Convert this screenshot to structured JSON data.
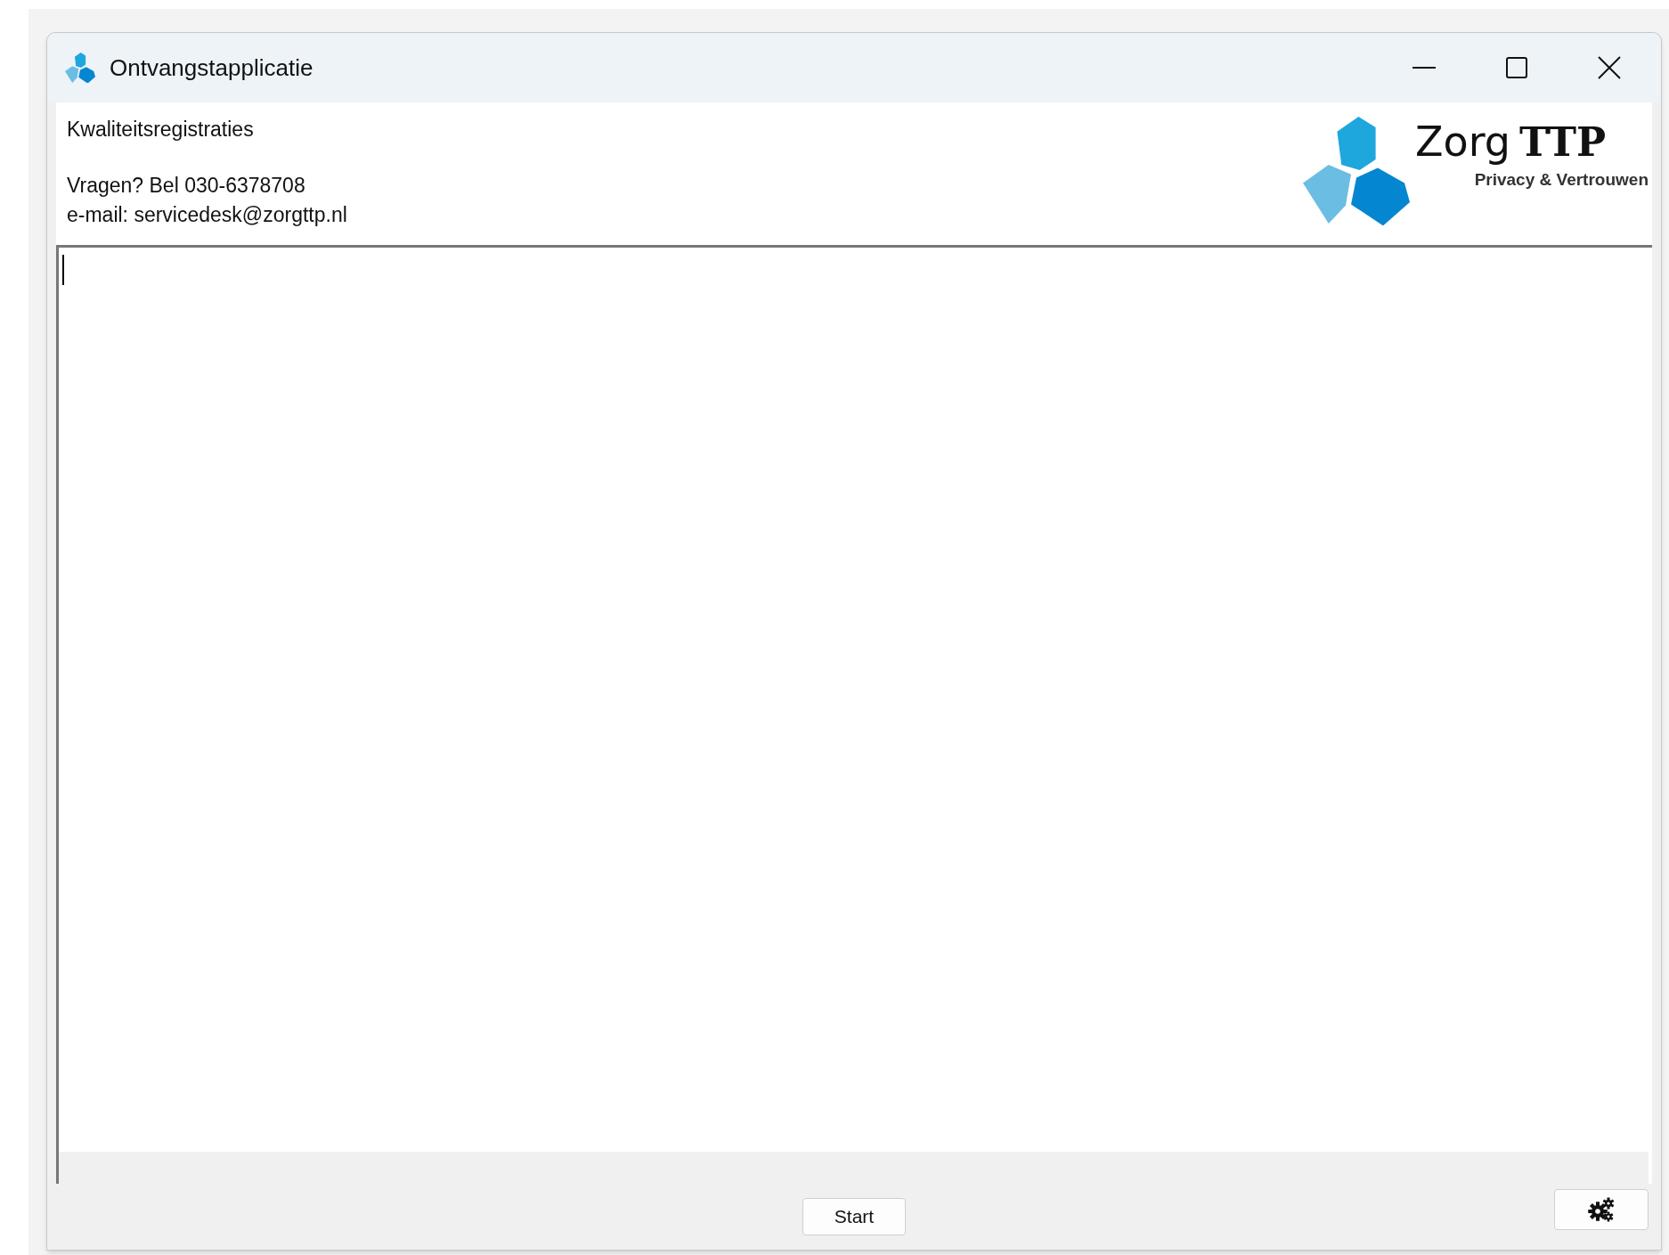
{
  "window": {
    "title": "Ontvangstapplicatie"
  },
  "header": {
    "title": "Kwaliteitsregistraties",
    "contact_lines": [
      "Vragen? Bel 030-6378708",
      "e-mail: servicedesk@zorgttp.nl"
    ]
  },
  "logo": {
    "word": "Zorg",
    "bold_word": "TTP",
    "tagline": "Privacy & Vertrouwen"
  },
  "buttons": [
    {
      "kind": "text",
      "label": "Start"
    },
    {
      "kind": "settings"
    }
  ]
}
